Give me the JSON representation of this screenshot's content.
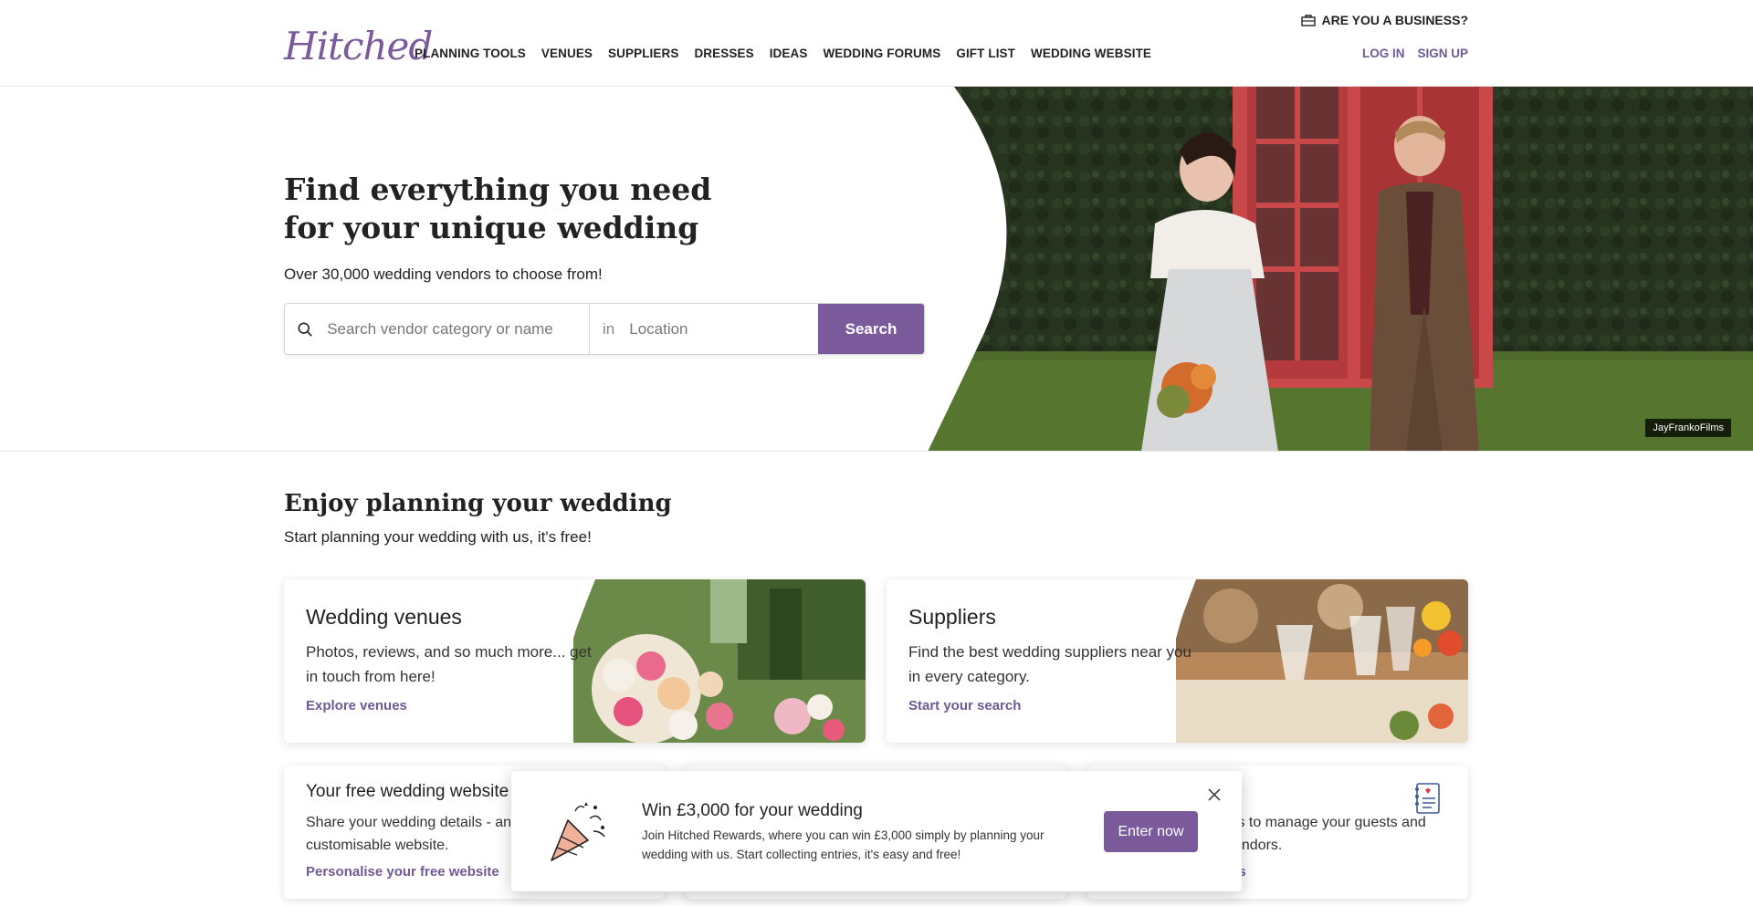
{
  "header": {
    "logo": "Hitched",
    "business_link": "ARE YOU A BUSINESS?",
    "nav": [
      "PLANNING TOOLS",
      "VENUES",
      "SUPPLIERS",
      "DRESSES",
      "IDEAS",
      "WEDDING FORUMS",
      "GIFT LIST",
      "WEDDING WEBSITE"
    ],
    "login": "LOG IN",
    "signup": "SIGN UP"
  },
  "hero": {
    "title": "Find everything you need for your unique wedding",
    "subtitle": "Over 30,000 wedding vendors to choose from!",
    "search_placeholder": "Search vendor category or name",
    "in_label": "in",
    "location_placeholder": "Location",
    "search_button": "Search",
    "photo_credit": "JayFrankoFilms"
  },
  "section": {
    "title": "Enjoy planning your wedding",
    "subtitle": "Start planning your wedding with us, it's free!"
  },
  "cards": [
    {
      "title": "Wedding venues",
      "desc": "Photos, reviews, and so much more... get in touch from here!",
      "link": "Explore venues"
    },
    {
      "title": "Suppliers",
      "desc": "Find the best wedding suppliers near you in every category.",
      "link": "Start your search"
    }
  ],
  "small_cards": [
    {
      "title": "Your free wedding website",
      "desc": "Share your wedding details - and story - with a customisable website.",
      "link": "Personalise your free website"
    },
    {
      "title": "",
      "desc": "",
      "link": ""
    },
    {
      "title": "",
      "desc": "ols to manage your guests and vendors.",
      "link": "ols"
    }
  ],
  "promo": {
    "title": "Win £3,000 for your wedding",
    "desc": "Join Hitched Rewards, where you can win £3,000 simply by planning your wedding with us. Start collecting entries, it's easy and free!",
    "button": "Enter now"
  },
  "colors": {
    "brand": "#7b5a9c",
    "link": "#6e5a94"
  }
}
